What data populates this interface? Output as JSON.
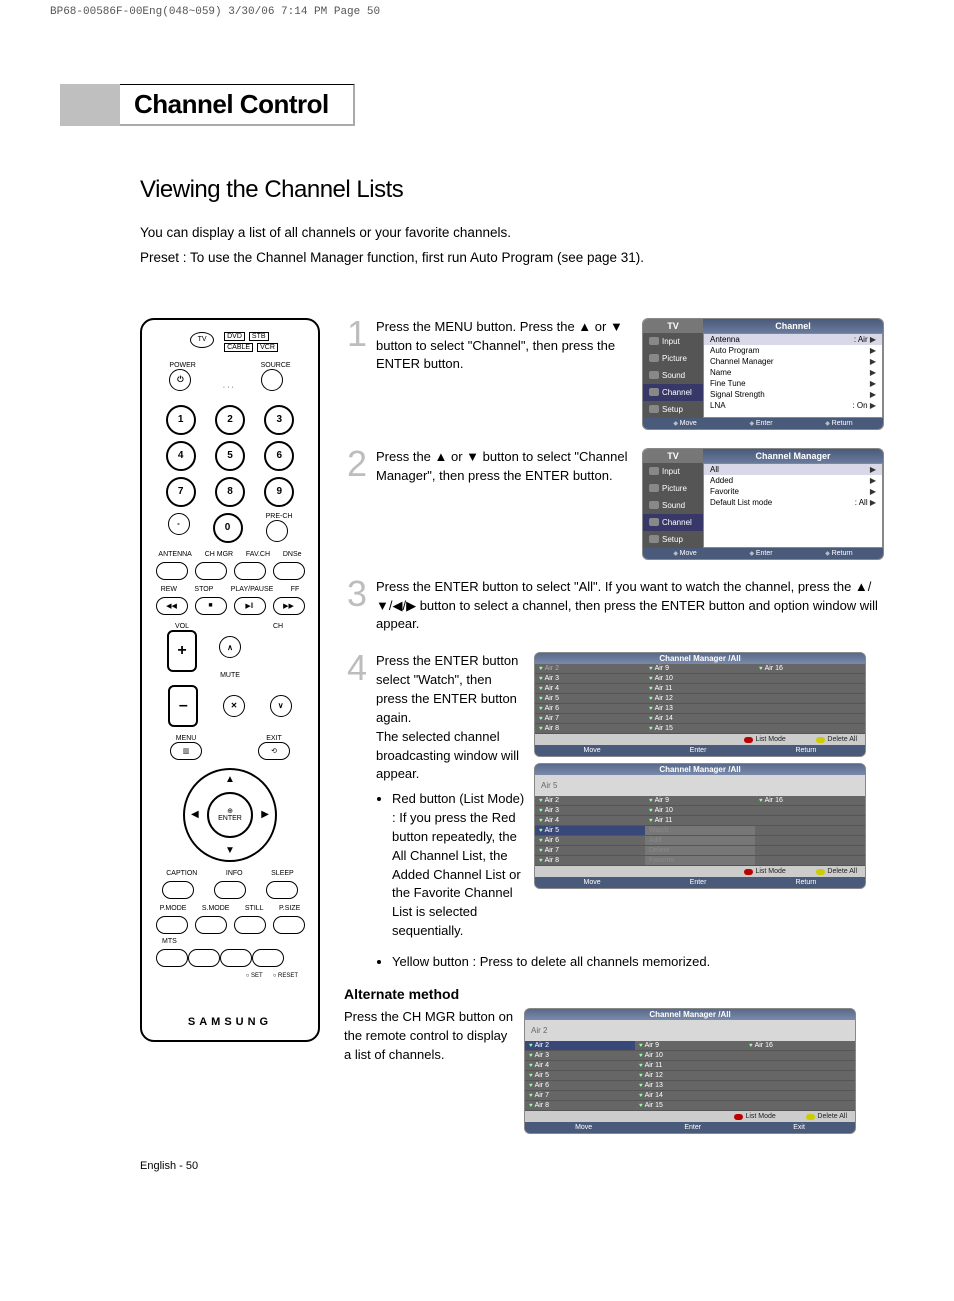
{
  "print_header": "BP68-00586F-00Eng(048~059)  3/30/06  7:14 PM  Page 50",
  "chapter_title": "Channel Control",
  "section_title": "Viewing the Channel Lists",
  "intro": {
    "p1": "You can display a list of all channels or your favorite channels.",
    "p2": "Preset : To use the Channel Manager function, first run Auto Program (see page 31)."
  },
  "remote": {
    "devices": [
      "DVD",
      "STB",
      "CABLE",
      "VCR"
    ],
    "tv_label": "TV",
    "power": "POWER",
    "source": "SOURCE",
    "digits": [
      "1",
      "2",
      "3",
      "4",
      "5",
      "6",
      "7",
      "8",
      "9",
      "0"
    ],
    "dash": "-",
    "prech": "PRE-CH",
    "row_labels": [
      "ANTENNA",
      "CH MGR",
      "FAV.CH",
      "DNSe"
    ],
    "transport": [
      "REW",
      "STOP",
      "PLAY/PAUSE",
      "FF"
    ],
    "vol": "VOL",
    "ch": "CH",
    "mute": "MUTE",
    "menu": "MENU",
    "exit": "EXIT",
    "enter": "ENTER",
    "caption": "CAPTION",
    "info": "INFO",
    "sleep": "SLEEP",
    "bottom_row": [
      "P.MODE",
      "S.MODE",
      "STILL",
      "P.SIZE"
    ],
    "mts": "MTS",
    "set": "○ SET",
    "reset": "○ RESET",
    "brand": "SAMSUNG"
  },
  "steps": {
    "s1": {
      "num": "1",
      "text": "Press the MENU button. Press the ▲ or ▼ button to select \"Channel\", then press the ENTER button."
    },
    "s2": {
      "num": "2",
      "text": "Press the ▲ or ▼ button to select \"Channel Manager\", then press the ENTER button."
    },
    "s3": {
      "num": "3",
      "text": "Press the ENTER button to select \"All\". If you want to watch the channel, press the ▲/▼/◀/▶ button to select a channel, then press the ENTER button and option window will appear."
    },
    "s4": {
      "num": "4",
      "text_a": "Press the ENTER button select \"Watch\", then press the ENTER button again.\nThe selected channel broadcasting window will appear.",
      "bullet1": "Red button (List Mode) : If you press the Red button repeatedly, the All Channel List, the Added Channel List or the Favorite Channel List is selected sequentially.",
      "bullet2": "Yellow button : Press to delete all channels memorized."
    }
  },
  "osd1": {
    "tv": "TV",
    "title": "Channel",
    "side": [
      "Input",
      "Picture",
      "Sound",
      "Channel",
      "Setup"
    ],
    "items": [
      {
        "label": "Antenna",
        "val": ": Air"
      },
      {
        "label": "Auto Program",
        "val": ""
      },
      {
        "label": "Channel Manager",
        "val": ""
      },
      {
        "label": "Name",
        "val": ""
      },
      {
        "label": "Fine Tune",
        "val": ""
      },
      {
        "label": "Signal Strength",
        "val": ""
      },
      {
        "label": "LNA",
        "val": ": On"
      }
    ],
    "foot": {
      "move": "Move",
      "enter": "Enter",
      "return": "Return"
    }
  },
  "osd2": {
    "tv": "TV",
    "title": "Channel Manager",
    "side": [
      "Input",
      "Picture",
      "Sound",
      "Channel",
      "Setup"
    ],
    "items": [
      {
        "label": "All",
        "val": ""
      },
      {
        "label": "Added",
        "val": ""
      },
      {
        "label": "Favorite",
        "val": ""
      },
      {
        "label": "Default List mode",
        "val": ": All"
      }
    ],
    "foot": {
      "move": "Move",
      "enter": "Enter",
      "return": "Return"
    }
  },
  "grid_title": "Channel Manager /All",
  "grid_preview_1": "Air 5",
  "grid_preview_2": "Air 2",
  "grid_cols": {
    "c1": [
      "Air 2",
      "Air 3",
      "Air 4",
      "Air 5",
      "Air 6",
      "Air 7",
      "Air 8"
    ],
    "c2": [
      "Air 9",
      "Air 10",
      "Air 11",
      "Air 12",
      "Air 13",
      "Air 14",
      "Air 15"
    ],
    "c3": [
      "Air 16",
      "",
      "",
      "",
      "",
      "",
      ""
    ]
  },
  "grid_opts": [
    "Watch",
    "Add",
    "Delete",
    "Favorite"
  ],
  "grid_foot": {
    "listmode": "List Mode",
    "deleteall": "Delete All"
  },
  "grid_bot": {
    "move": "Move",
    "enter": "Enter",
    "return": "Return",
    "exit": "Exit"
  },
  "alt_method": {
    "heading": "Alternate method",
    "text": "Press the CH MGR button on the remote control to display a list of channels."
  },
  "page_footer": "English - 50"
}
